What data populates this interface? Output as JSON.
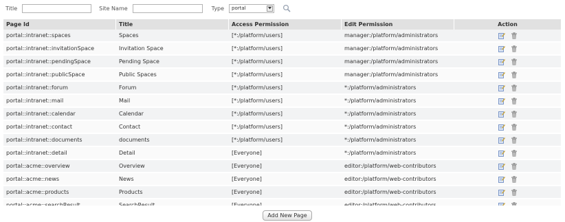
{
  "filters": {
    "title_label": "Title",
    "title_value": "",
    "site_name_label": "Site Name",
    "site_name_value": "",
    "type_label": "Type",
    "type_value": "portal"
  },
  "table": {
    "headers": [
      "Page Id",
      "Title",
      "Access Permission",
      "Edit Permission",
      "Action"
    ],
    "rows": [
      {
        "id": "portal::intranet::spaces",
        "title": "Spaces",
        "access": "[*:/platform/users]",
        "edit": "manager:/platform/administrators"
      },
      {
        "id": "portal::intranet::invitationSpace",
        "title": "Invitation Space",
        "access": "[*:/platform/users]",
        "edit": "manager:/platform/administrators"
      },
      {
        "id": "portal::intranet::pendingSpace",
        "title": "Pending Space",
        "access": "[*:/platform/users]",
        "edit": "manager:/platform/administrators"
      },
      {
        "id": "portal::intranet::publicSpace",
        "title": "Public Spaces",
        "access": "[*:/platform/users]",
        "edit": "manager:/platform/administrators"
      },
      {
        "id": "portal::intranet::forum",
        "title": "Forum",
        "access": "[*:/platform/users]",
        "edit": "*:/platform/administrators"
      },
      {
        "id": "portal::intranet::mail",
        "title": "Mail",
        "access": "[*:/platform/users]",
        "edit": "*:/platform/administrators"
      },
      {
        "id": "portal::intranet::calendar",
        "title": "Calendar",
        "access": "[*:/platform/users]",
        "edit": "*:/platform/administrators"
      },
      {
        "id": "portal::intranet::contact",
        "title": "Contact",
        "access": "[*:/platform/users]",
        "edit": "*:/platform/administrators"
      },
      {
        "id": "portal::intranet::documents",
        "title": "documents",
        "access": "[*:/platform/users]",
        "edit": "*:/platform/administrators"
      },
      {
        "id": "portal::intranet::detail",
        "title": "Detail",
        "access": "[Everyone]",
        "edit": "*:/platform/administrators"
      },
      {
        "id": "portal::acme::overview",
        "title": "Overview",
        "access": "[Everyone]",
        "edit": "editor:/platform/web-contributors"
      },
      {
        "id": "portal::acme::news",
        "title": "News",
        "access": "[Everyone]",
        "edit": "editor:/platform/web-contributors"
      },
      {
        "id": "portal::acme::products",
        "title": "Products",
        "access": "[Everyone]",
        "edit": "editor:/platform/web-contributors"
      },
      {
        "id": "portal::acme::searchResult",
        "title": "SearchResult",
        "access": "[Everyone]",
        "edit": "editor:/platform/web-contributors"
      }
    ],
    "row_actions": [
      "edit-icon",
      "delete-icon"
    ]
  },
  "footer": {
    "add_button_label": "Add New Page"
  },
  "colors": {
    "header_bg": "#e1e1e1",
    "row_odd_bg": "#f2f3f4",
    "row_even_bg": "#fafafa",
    "edit_icon": "#6f8fc9",
    "delete_icon": "#8a8a8a"
  }
}
